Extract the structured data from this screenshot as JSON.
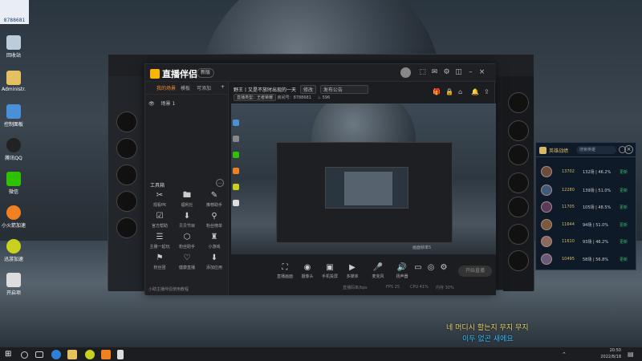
{
  "desktop": {
    "top_label": "8788681",
    "icons": [
      {
        "label": "回收站"
      },
      {
        "label": "Administr..."
      },
      {
        "label": "控制面板"
      },
      {
        "label": "腾讯QQ"
      },
      {
        "label": "微信"
      },
      {
        "label": "小火箭加速"
      },
      {
        "label": "迅游加速"
      },
      {
        "label": "开启项"
      }
    ]
  },
  "app": {
    "logo": "直播伴侣",
    "version_badge": "新版",
    "left_tabs": [
      "我的场景",
      "模板",
      "可添加"
    ],
    "scene_item": "场景 1",
    "tools_title": "工具箱",
    "tools": [
      {
        "label": "观看PK",
        "icon": "✂"
      },
      {
        "label": "福利社",
        "icon": "🖿"
      },
      {
        "label": "推荐助手",
        "icon": "✎"
      },
      {
        "label": "官方帮助",
        "icon": "☑"
      },
      {
        "label": "贝贝节目",
        "icon": "⬇"
      },
      {
        "label": "粉丝榜单",
        "icon": "⚲"
      },
      {
        "label": "主播一起玩",
        "icon": "☰"
      },
      {
        "label": "粉丝助手",
        "icon": "⬡"
      },
      {
        "label": "小游戏",
        "icon": "♜"
      },
      {
        "label": "粉丝团",
        "icon": "⚑"
      },
      {
        "label": "健康直播",
        "icon": "♡"
      },
      {
        "label": "添加应用",
        "icon": "⬇"
      }
    ],
    "left_footer": "小助主播伴侣使用教程",
    "room_title": "野王丨又是不放时出现的一天",
    "edit_label": "修改",
    "announcement": "发布公告",
    "room_type": "直播类型：王者荣耀",
    "room_id_label": "房间号：",
    "room_id": "8788681",
    "hot": "596",
    "bottom_buttons": [
      {
        "label": "直播画面",
        "icon": "⛶"
      },
      {
        "label": "摄像头",
        "icon": "◉"
      },
      {
        "label": "手机投屏",
        "icon": "▣"
      },
      {
        "label": "多媒体",
        "icon": "▶"
      },
      {
        "label": "麦克风",
        "icon": "🎤"
      },
      {
        "label": "扬声器",
        "icon": "🔊"
      }
    ],
    "go_live": "开始直播",
    "status_items": [
      "直播码率/bps",
      "FPS 25",
      "CPU 41%",
      "内存 30%"
    ],
    "preview_caption": "画面帧率5"
  },
  "hero_panel": {
    "title": "英雄战绩",
    "search_placeholder": "搜索英雄",
    "close": "×",
    "rows": [
      {
        "score": "13702",
        "record": "132场 | 46.2%",
        "action": "更新"
      },
      {
        "score": "12280",
        "record": "139场 | 51.0%",
        "action": "更新"
      },
      {
        "score": "11705",
        "record": "105场 | 48.5%",
        "action": "更新"
      },
      {
        "score": "11644",
        "record": "94场 | 51.0%",
        "action": "更新"
      },
      {
        "score": "11610",
        "record": "93场 | 46.2%",
        "action": "更新"
      },
      {
        "score": "10495",
        "record": "58场 | 56.8%",
        "action": "更新"
      }
    ]
  },
  "subtitle": {
    "line1": "네 머디시 할는지 무지 무지",
    "line2": "이두 없곤 새에요"
  },
  "taskbar": {
    "time": "20:50",
    "date": "2022/8/18"
  },
  "colors": {
    "accent": "#f38b2e",
    "gold": "#d6b76a",
    "update_green": "#39b36a",
    "subtitle_yellow": "#e8d770"
  }
}
